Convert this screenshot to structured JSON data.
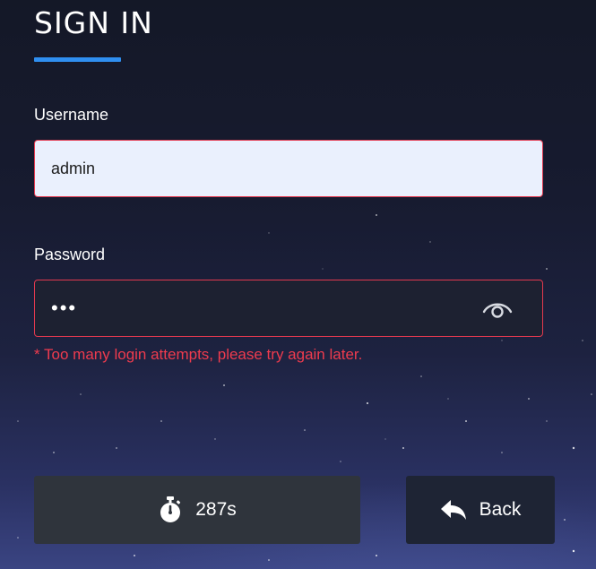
{
  "form": {
    "title": "SIGN IN",
    "username_label": "Username",
    "username_value": "admin",
    "password_label": "Password",
    "password_value": "•••",
    "error_message": "* Too many login attempts, please try again later."
  },
  "actions": {
    "countdown_label": "287s",
    "back_label": "Back"
  },
  "icons": {
    "countdown": "stopwatch-icon",
    "back": "reply-arrow-icon",
    "toggle_password": "eye-icon"
  },
  "colors": {
    "accent": "#2f8ff0",
    "error": "#ef3b4e"
  }
}
